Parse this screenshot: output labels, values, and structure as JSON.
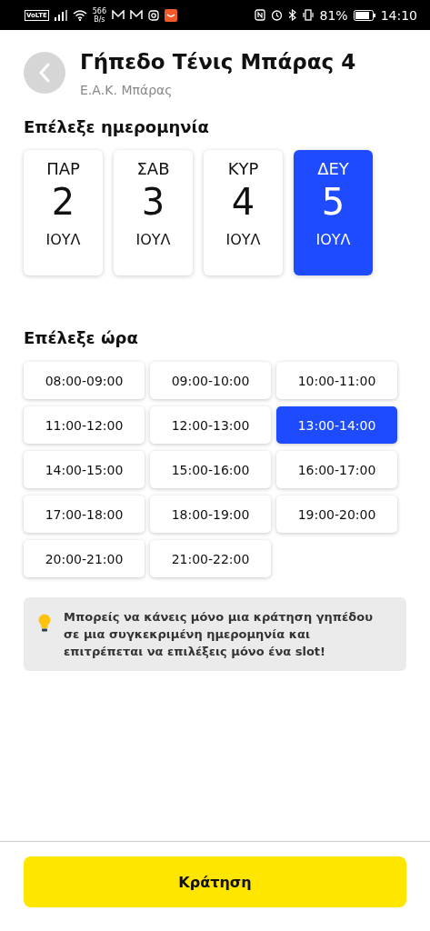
{
  "status_bar": {
    "volte": "VoLTE",
    "speed_value": "566",
    "speed_unit": "B/s",
    "battery": "81%",
    "time": "14:10"
  },
  "header": {
    "title": "Γήπεδο Τένις Μπάρας 4",
    "subtitle": "Ε.Α.Κ. Μπάρας"
  },
  "date_section": {
    "title": "Επέλεξε ημερομηνία",
    "dates": [
      {
        "weekday": "ΠΑΡ",
        "day": "2",
        "month": "ΙΟΥΛ",
        "selected": false
      },
      {
        "weekday": "ΣΑΒ",
        "day": "3",
        "month": "ΙΟΥΛ",
        "selected": false
      },
      {
        "weekday": "ΚΥΡ",
        "day": "4",
        "month": "ΙΟΥΛ",
        "selected": false
      },
      {
        "weekday": "ΔΕΥ",
        "day": "5",
        "month": "ΙΟΥΛ",
        "selected": true
      }
    ]
  },
  "time_section": {
    "title": "Επέλεξε ώρα",
    "slots": [
      {
        "label": "08:00-09:00",
        "selected": false
      },
      {
        "label": "09:00-10:00",
        "selected": false
      },
      {
        "label": "10:00-11:00",
        "selected": false
      },
      {
        "label": "11:00-12:00",
        "selected": false
      },
      {
        "label": "12:00-13:00",
        "selected": false
      },
      {
        "label": "13:00-14:00",
        "selected": true
      },
      {
        "label": "14:00-15:00",
        "selected": false
      },
      {
        "label": "15:00-16:00",
        "selected": false
      },
      {
        "label": "16:00-17:00",
        "selected": false
      },
      {
        "label": "17:00-18:00",
        "selected": false
      },
      {
        "label": "18:00-19:00",
        "selected": false
      },
      {
        "label": "19:00-20:00",
        "selected": false
      },
      {
        "label": "20:00-21:00",
        "selected": false
      },
      {
        "label": "21:00-22:00",
        "selected": false
      }
    ]
  },
  "info": {
    "text": "Μπορείς να κάνεις μόνο μια κράτηση γηπέδου σε μια συγκεκριμένη ημερομηνία και επιτρέπεται να επιλέξεις μόνο ένα slot!"
  },
  "book_button": {
    "label": "Κράτηση"
  }
}
